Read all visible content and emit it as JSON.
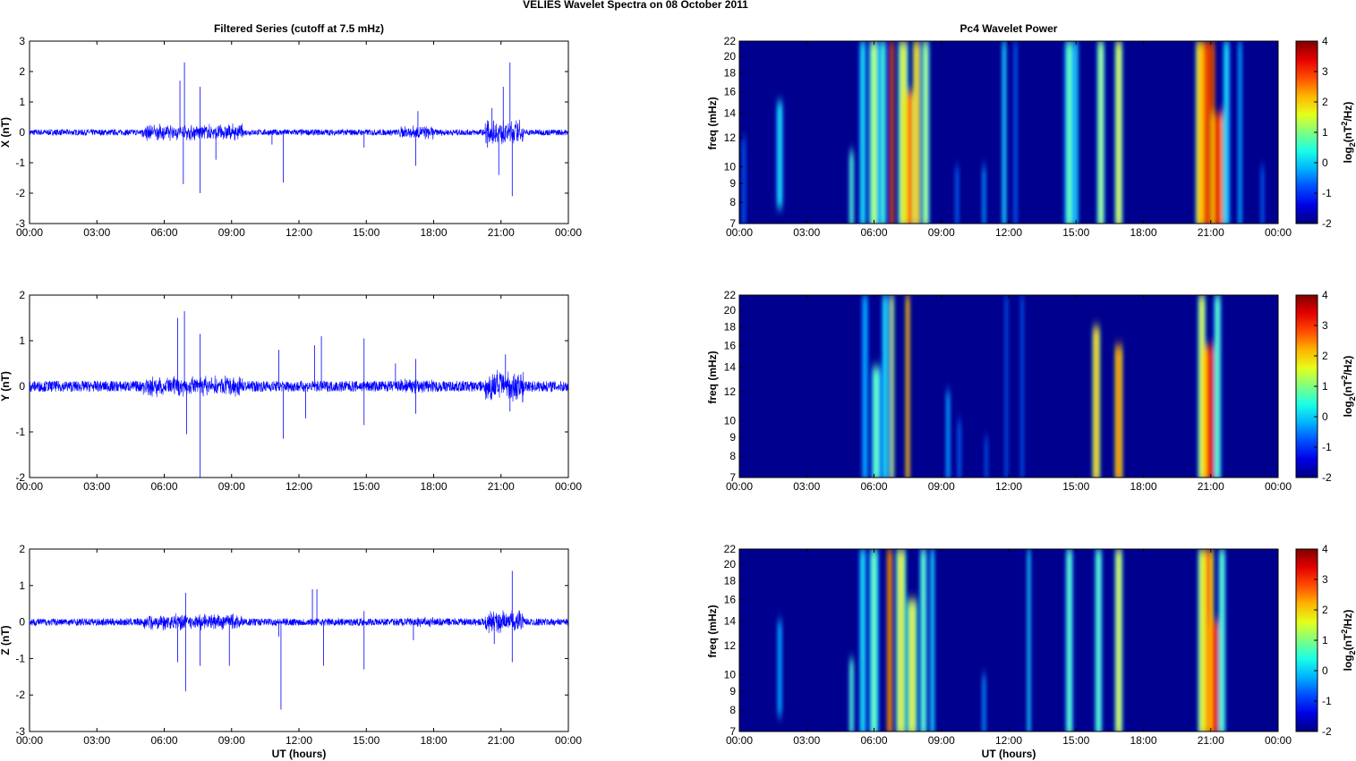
{
  "title": "VELIES Wavelet Spectra on 08 October   2011",
  "chart_data": [
    {
      "type": "line",
      "title": "Filtered Series (cutoff at 7.5 mHz)",
      "ylabel": "X (nT)",
      "xlabel": "",
      "ylim": [
        -3,
        3
      ],
      "yticks": [
        -3,
        -2,
        -1,
        0,
        1,
        2,
        3
      ],
      "xlim": [
        0,
        24
      ],
      "xticks": [
        "00:00",
        "03:00",
        "06:00",
        "09:00",
        "12:00",
        "15:00",
        "18:00",
        "21:00",
        "00:00"
      ],
      "color": "#0000ff",
      "noise_amplitude_nT": 0.1,
      "active_intervals": [
        [
          5,
          9.5,
          0.3
        ],
        [
          16.5,
          18,
          0.25
        ],
        [
          20.3,
          22,
          0.45
        ]
      ],
      "spikes": [
        [
          6.7,
          1.7
        ],
        [
          6.9,
          2.3
        ],
        [
          6.85,
          -1.7
        ],
        [
          7.6,
          1.5
        ],
        [
          7.6,
          -2.0
        ],
        [
          8.3,
          -0.9
        ],
        [
          10.8,
          -0.4
        ],
        [
          11.3,
          -1.65
        ],
        [
          14.9,
          -0.5
        ],
        [
          17.2,
          -1.1
        ],
        [
          17.3,
          0.7
        ],
        [
          20.4,
          -0.5
        ],
        [
          20.6,
          0.8
        ],
        [
          20.9,
          -1.4
        ],
        [
          21.1,
          1.5
        ],
        [
          21.4,
          2.3
        ],
        [
          21.5,
          -2.1
        ]
      ]
    },
    {
      "type": "line",
      "title": "",
      "ylabel": "Y (nT)",
      "xlabel": "",
      "ylim": [
        -2,
        2
      ],
      "yticks": [
        -2,
        -1,
        0,
        1,
        2
      ],
      "xlim": [
        0,
        24
      ],
      "xticks": [
        "00:00",
        "03:00",
        "06:00",
        "09:00",
        "12:00",
        "15:00",
        "18:00",
        "21:00",
        "00:00"
      ],
      "color": "#0000ff",
      "noise_amplitude_nT": 0.12,
      "active_intervals": [
        [
          5,
          9.5,
          0.25
        ],
        [
          16.5,
          18,
          0.2
        ],
        [
          20.3,
          22,
          0.4
        ]
      ],
      "spikes": [
        [
          6.6,
          1.5
        ],
        [
          6.9,
          1.65
        ],
        [
          7.0,
          -1.05
        ],
        [
          7.6,
          1.15
        ],
        [
          7.6,
          -2.0
        ],
        [
          11.1,
          0.8
        ],
        [
          11.3,
          -1.15
        ],
        [
          12.3,
          -0.7
        ],
        [
          12.7,
          0.9
        ],
        [
          13.0,
          1.1
        ],
        [
          14.9,
          1.05
        ],
        [
          14.9,
          -0.85
        ],
        [
          16.3,
          0.5
        ],
        [
          17.2,
          0.6
        ],
        [
          17.2,
          -0.6
        ],
        [
          21.2,
          0.7
        ],
        [
          21.4,
          -0.55
        ]
      ]
    },
    {
      "type": "line",
      "title": "",
      "ylabel": "Z (nT)",
      "xlabel": "UT (hours)",
      "ylim": [
        -3,
        2
      ],
      "yticks": [
        -3,
        -2,
        -1,
        0,
        1,
        2
      ],
      "xlim": [
        0,
        24
      ],
      "xticks": [
        "00:00",
        "03:00",
        "06:00",
        "09:00",
        "12:00",
        "15:00",
        "18:00",
        "21:00",
        "00:00"
      ],
      "color": "#0000ff",
      "noise_amplitude_nT": 0.1,
      "active_intervals": [
        [
          5,
          9.5,
          0.25
        ],
        [
          16.5,
          18,
          0.15
        ],
        [
          20.3,
          22,
          0.35
        ]
      ],
      "spikes": [
        [
          6.6,
          -1.1
        ],
        [
          6.95,
          0.8
        ],
        [
          6.95,
          -1.9
        ],
        [
          7.6,
          -1.2
        ],
        [
          8.9,
          -1.2
        ],
        [
          11.1,
          -0.4
        ],
        [
          11.2,
          -2.4
        ],
        [
          12.6,
          0.9
        ],
        [
          12.8,
          0.9
        ],
        [
          13.1,
          -1.2
        ],
        [
          14.9,
          -1.3
        ],
        [
          14.9,
          0.3
        ],
        [
          17.1,
          -0.5
        ],
        [
          20.7,
          -0.6
        ],
        [
          21.5,
          1.4
        ],
        [
          21.5,
          -1.1
        ]
      ]
    },
    {
      "type": "heatmap",
      "title": "Pc4 Wavelet Power",
      "ylabel": "freq (mHz)",
      "xlabel": "",
      "ylim": [
        7,
        22
      ],
      "yscale": "log",
      "yticks": [
        7,
        8,
        9,
        10,
        12,
        14,
        16,
        18,
        20,
        22
      ],
      "xlim": [
        0,
        24
      ],
      "xticks": [
        "00:00",
        "03:00",
        "06:00",
        "09:00",
        "12:00",
        "15:00",
        "18:00",
        "21:00",
        "00:00"
      ],
      "colorbar": {
        "label": "log2(nT^2/Hz)",
        "range": [
          -2,
          4
        ],
        "ticks": [
          -2,
          -1,
          0,
          1,
          2,
          3,
          4
        ],
        "colormap": "jet"
      },
      "bursts_hour_power_fmin_fmax_width": [
        [
          0.2,
          -0.5,
          7,
          12,
          0.1
        ],
        [
          1.8,
          0.5,
          8,
          15,
          0.15
        ],
        [
          5.0,
          1,
          7,
          11,
          0.1
        ],
        [
          5.5,
          0.5,
          7,
          22,
          0.15
        ],
        [
          6.0,
          1.5,
          7,
          22,
          0.2
        ],
        [
          6.4,
          0.8,
          7,
          22,
          0.15
        ],
        [
          6.8,
          4,
          7,
          22,
          0.08
        ],
        [
          7.3,
          2,
          7,
          22,
          0.2
        ],
        [
          7.6,
          3,
          7,
          16,
          0.2
        ],
        [
          7.9,
          2.5,
          7,
          22,
          0.15
        ],
        [
          8.3,
          1.5,
          7,
          22,
          0.15
        ],
        [
          9.7,
          -0.5,
          7,
          10,
          0.1
        ],
        [
          10.9,
          0,
          7,
          10,
          0.08
        ],
        [
          11.8,
          0.5,
          7,
          22,
          0.1
        ],
        [
          12.3,
          -0.5,
          7,
          22,
          0.1
        ],
        [
          14.7,
          1,
          7,
          22,
          0.2
        ],
        [
          15.0,
          0.5,
          7,
          22,
          0.1
        ],
        [
          16.1,
          1.5,
          7,
          22,
          0.15
        ],
        [
          16.9,
          2,
          7,
          22,
          0.15
        ],
        [
          20.5,
          2.5,
          7,
          22,
          0.15
        ],
        [
          20.8,
          3.5,
          7,
          22,
          0.2
        ],
        [
          21.0,
          4,
          7,
          22,
          0.15
        ],
        [
          21.3,
          3.5,
          7,
          14,
          0.25
        ],
        [
          21.7,
          0.5,
          7,
          22,
          0.15
        ],
        [
          22.3,
          0,
          7,
          22,
          0.1
        ],
        [
          23.3,
          -0.5,
          7,
          10,
          0.1
        ]
      ]
    },
    {
      "type": "heatmap",
      "title": "",
      "ylabel": "freq (mHz)",
      "xlabel": "",
      "ylim": [
        7,
        22
      ],
      "yscale": "log",
      "yticks": [
        7,
        8,
        9,
        10,
        12,
        14,
        16,
        18,
        20,
        22
      ],
      "xlim": [
        0,
        24
      ],
      "xticks": [
        "00:00",
        "03:00",
        "06:00",
        "09:00",
        "12:00",
        "15:00",
        "18:00",
        "21:00",
        "00:00"
      ],
      "colorbar": {
        "label": "log2(nT^2/Hz)",
        "range": [
          -2,
          4
        ],
        "ticks": [
          -2,
          -1,
          0,
          1,
          2,
          3,
          4
        ],
        "colormap": "jet"
      },
      "bursts_hour_power_fmin_fmax_width": [
        [
          5.6,
          0,
          7,
          22,
          0.15
        ],
        [
          6.1,
          1,
          7,
          14,
          0.2
        ],
        [
          6.5,
          0.5,
          7,
          22,
          0.15
        ],
        [
          6.8,
          2,
          7,
          22,
          0.08
        ],
        [
          7.5,
          3,
          7,
          22,
          0.08
        ],
        [
          9.3,
          0,
          7,
          12,
          0.1
        ],
        [
          9.8,
          -0.5,
          7,
          10,
          0.1
        ],
        [
          11.0,
          -0.5,
          7,
          9,
          0.08
        ],
        [
          11.9,
          -0.5,
          7,
          22,
          0.08
        ],
        [
          12.6,
          -0.5,
          7,
          22,
          0.08
        ],
        [
          15.9,
          2.5,
          7,
          18,
          0.15
        ],
        [
          16.9,
          3,
          7,
          16,
          0.15
        ],
        [
          20.6,
          2,
          7,
          22,
          0.15
        ],
        [
          21.0,
          3.5,
          7,
          16,
          0.3
        ],
        [
          21.3,
          1,
          7,
          22,
          0.15
        ]
      ]
    },
    {
      "type": "heatmap",
      "title": "",
      "ylabel": "freq (mHz)",
      "xlabel": "UT (hours)",
      "ylim": [
        7,
        22
      ],
      "yscale": "log",
      "yticks": [
        7,
        8,
        9,
        10,
        12,
        14,
        16,
        18,
        20,
        22
      ],
      "xlim": [
        0,
        24
      ],
      "xticks": [
        "00:00",
        "03:00",
        "06:00",
        "09:00",
        "12:00",
        "15:00",
        "18:00",
        "21:00",
        "00:00"
      ],
      "colorbar": {
        "label": "log2(nT^2/Hz)",
        "range": [
          -2,
          4
        ],
        "ticks": [
          -2,
          -1,
          0,
          1,
          2,
          3,
          4
        ],
        "colormap": "jet"
      },
      "bursts_hour_power_fmin_fmax_width": [
        [
          1.8,
          0,
          8,
          14,
          0.12
        ],
        [
          5.0,
          1,
          7,
          11,
          0.1
        ],
        [
          5.5,
          0.5,
          7,
          22,
          0.15
        ],
        [
          6.0,
          1,
          7,
          22,
          0.2
        ],
        [
          6.7,
          3.5,
          7,
          22,
          0.1
        ],
        [
          7.2,
          2,
          7,
          22,
          0.2
        ],
        [
          7.7,
          2,
          7,
          16,
          0.2
        ],
        [
          8.2,
          1,
          7,
          22,
          0.15
        ],
        [
          8.6,
          0.5,
          7,
          22,
          0.1
        ],
        [
          10.9,
          0,
          7,
          10,
          0.08
        ],
        [
          12.9,
          0.5,
          7,
          22,
          0.06
        ],
        [
          14.7,
          1,
          7,
          22,
          0.15
        ],
        [
          16.0,
          1,
          7,
          22,
          0.15
        ],
        [
          16.9,
          2,
          7,
          22,
          0.15
        ],
        [
          20.6,
          2,
          7,
          22,
          0.15
        ],
        [
          20.9,
          3,
          7,
          22,
          0.2
        ],
        [
          21.2,
          3.5,
          7,
          14,
          0.25
        ],
        [
          21.5,
          1,
          7,
          22,
          0.15
        ]
      ]
    }
  ]
}
